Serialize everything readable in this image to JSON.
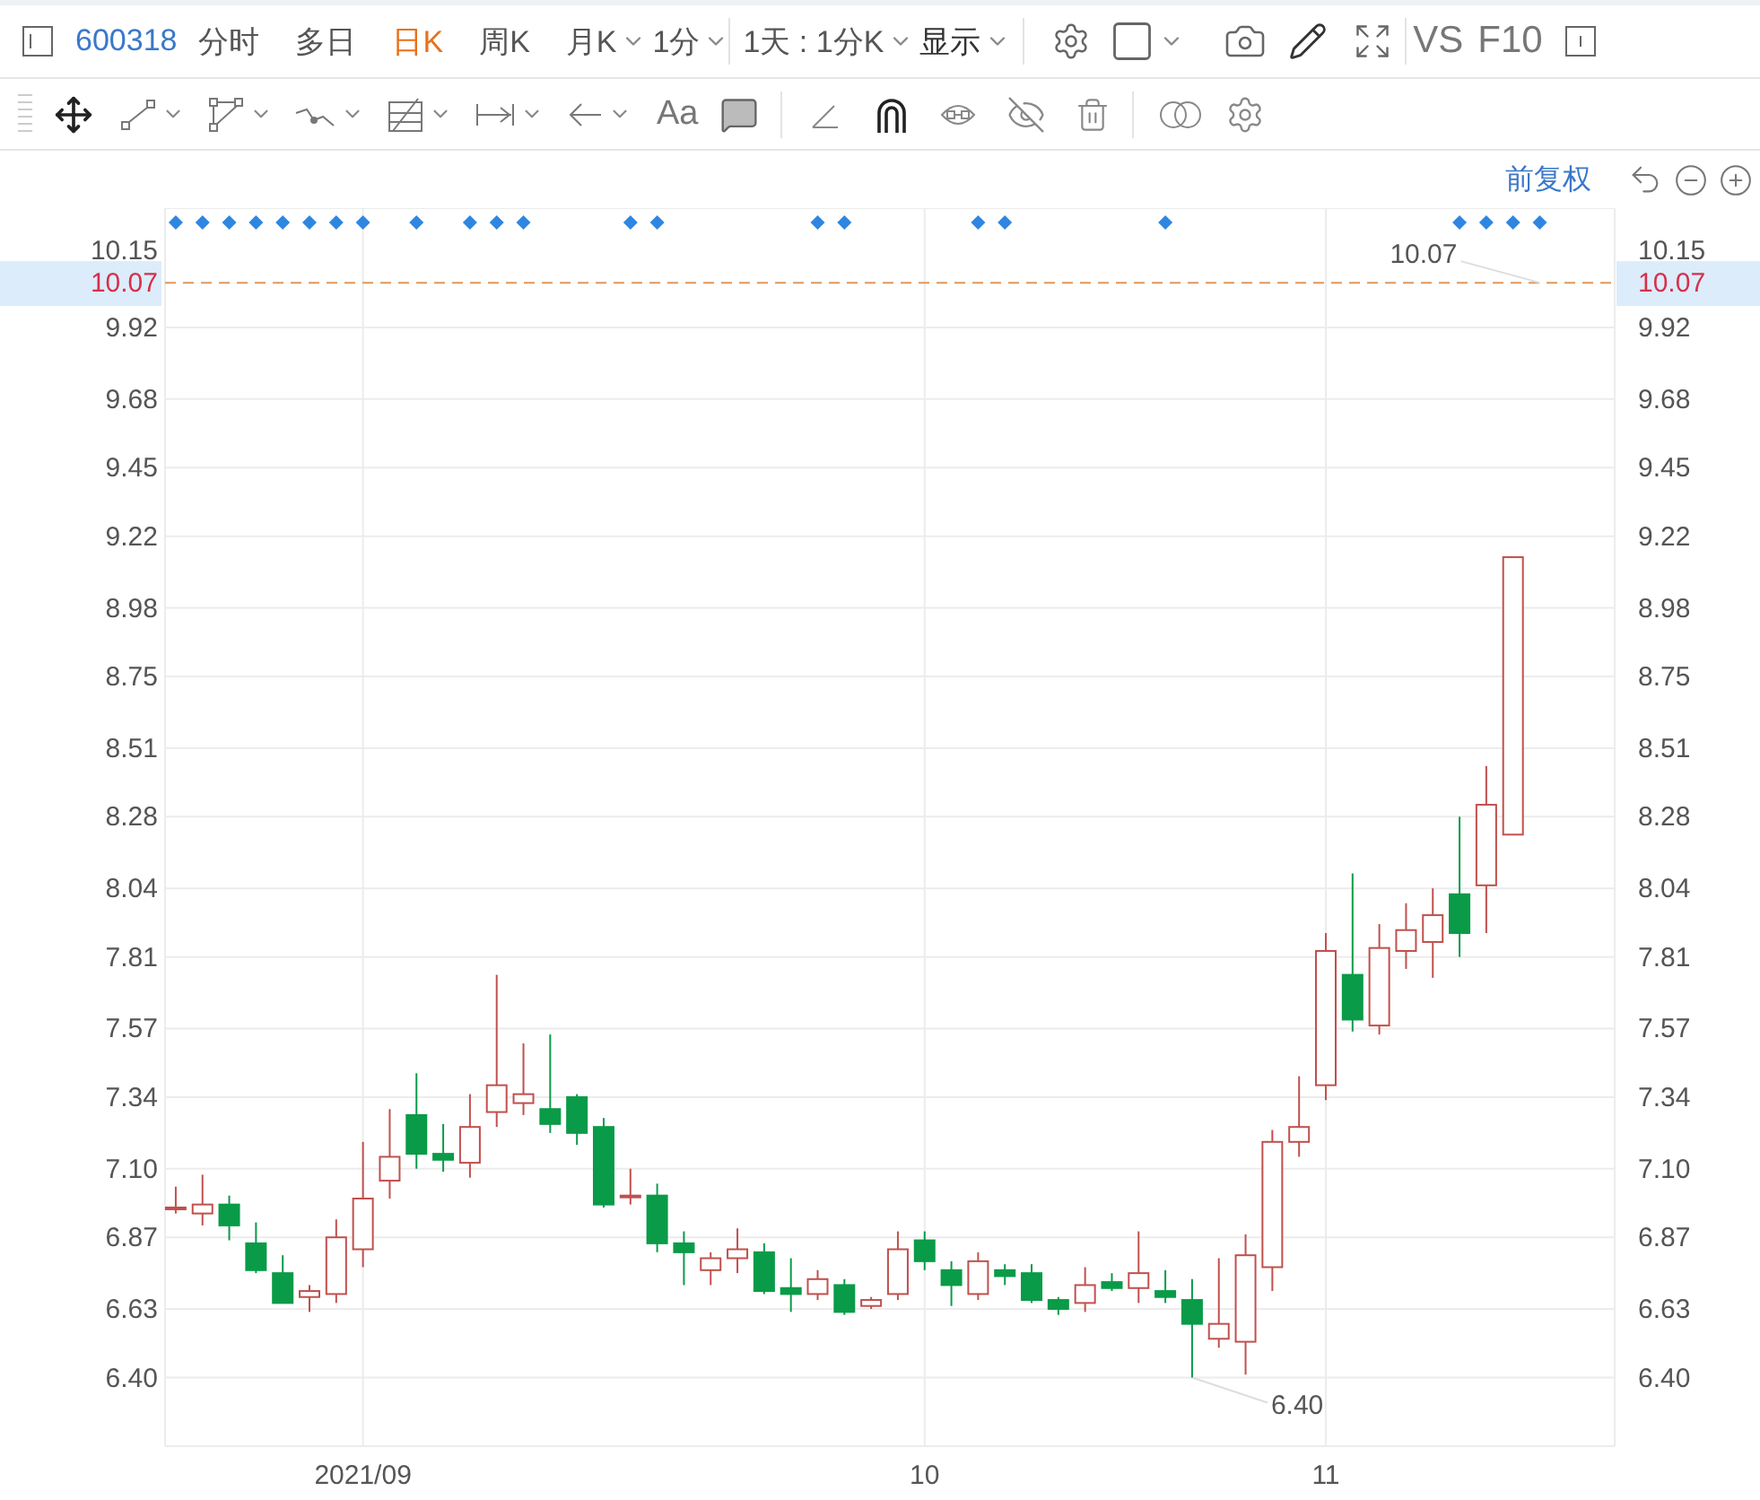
{
  "toolbar": {
    "symbol": "600318",
    "tabs": [
      {
        "label": "分时",
        "selected": false,
        "dropdown": false
      },
      {
        "label": "多日",
        "selected": false,
        "dropdown": false
      },
      {
        "label": "日K",
        "selected": true,
        "dropdown": false
      },
      {
        "label": "周K",
        "selected": false,
        "dropdown": false
      },
      {
        "label": "月K",
        "selected": false,
        "dropdown": true
      },
      {
        "label": "1分",
        "selected": false,
        "dropdown": true
      }
    ],
    "period": "1天 : 1分K",
    "display": "显示",
    "compare": "VS",
    "f10": "F10"
  },
  "drawing_toolbar": {
    "text_tool": "Aa"
  },
  "chart_header": {
    "adjust": "前复权"
  },
  "chart": {
    "price_tags": [
      "10.07",
      "10.07"
    ],
    "chart_data": {
      "type": "candlestick",
      "categories": [
        null,
        null,
        null,
        null,
        null,
        null,
        null,
        "2021/09",
        null,
        null,
        null,
        null,
        null,
        null,
        null,
        null,
        null,
        null,
        null,
        null,
        null,
        null,
        null,
        null,
        null,
        null,
        null,
        null,
        "10",
        null,
        null,
        null,
        null,
        null,
        null,
        null,
        null,
        null,
        null,
        null,
        null,
        null,
        null,
        "11",
        null,
        null,
        null,
        null,
        null,
        null,
        null
      ],
      "ohlc": [
        [
          6.97,
          7.04,
          6.95,
          6.97
        ],
        [
          6.95,
          7.08,
          6.91,
          6.98
        ],
        [
          6.98,
          7.01,
          6.86,
          6.91
        ],
        [
          6.85,
          6.92,
          6.75,
          6.76
        ],
        [
          6.75,
          6.81,
          6.65,
          6.65
        ],
        [
          6.67,
          6.71,
          6.62,
          6.69
        ],
        [
          6.68,
          6.93,
          6.65,
          6.87
        ],
        [
          6.83,
          7.19,
          6.77,
          7.0
        ],
        [
          7.06,
          7.3,
          7.0,
          7.14
        ],
        [
          7.28,
          7.42,
          7.1,
          7.15
        ],
        [
          7.15,
          7.25,
          7.09,
          7.13
        ],
        [
          7.12,
          7.35,
          7.07,
          7.24
        ],
        [
          7.29,
          7.75,
          7.24,
          7.38
        ],
        [
          7.32,
          7.52,
          7.28,
          7.35
        ],
        [
          7.3,
          7.55,
          7.22,
          7.25
        ],
        [
          7.34,
          7.35,
          7.18,
          7.22
        ],
        [
          7.24,
          7.27,
          6.97,
          6.98
        ],
        [
          7.01,
          7.1,
          6.98,
          7.01
        ],
        [
          7.01,
          7.05,
          6.82,
          6.85
        ],
        [
          6.85,
          6.89,
          6.71,
          6.82
        ],
        [
          6.76,
          6.82,
          6.71,
          6.8
        ],
        [
          6.8,
          6.9,
          6.75,
          6.83
        ],
        [
          6.82,
          6.85,
          6.68,
          6.69
        ],
        [
          6.7,
          6.8,
          6.62,
          6.68
        ],
        [
          6.68,
          6.76,
          6.66,
          6.73
        ],
        [
          6.71,
          6.73,
          6.61,
          6.62
        ],
        [
          6.64,
          6.67,
          6.63,
          6.66
        ],
        [
          6.68,
          6.89,
          6.66,
          6.83
        ],
        [
          6.86,
          6.89,
          6.76,
          6.79
        ],
        [
          6.76,
          6.79,
          6.64,
          6.71
        ],
        [
          6.68,
          6.82,
          6.66,
          6.79
        ],
        [
          6.76,
          6.78,
          6.71,
          6.74
        ],
        [
          6.75,
          6.78,
          6.65,
          6.66
        ],
        [
          6.66,
          6.67,
          6.61,
          6.63
        ],
        [
          6.65,
          6.77,
          6.62,
          6.71
        ],
        [
          6.72,
          6.75,
          6.69,
          6.7
        ],
        [
          6.7,
          6.89,
          6.65,
          6.75
        ],
        [
          6.69,
          6.76,
          6.65,
          6.67
        ],
        [
          6.66,
          6.73,
          6.4,
          6.58
        ],
        [
          6.53,
          6.8,
          6.5,
          6.58
        ],
        [
          6.52,
          6.88,
          6.41,
          6.81
        ],
        [
          6.77,
          7.23,
          6.69,
          7.19
        ],
        [
          7.19,
          7.41,
          7.14,
          7.24
        ],
        [
          7.38,
          7.89,
          7.33,
          7.83
        ],
        [
          7.75,
          8.09,
          7.56,
          7.6
        ],
        [
          7.58,
          7.92,
          7.55,
          7.84
        ],
        [
          7.83,
          7.99,
          7.77,
          7.9
        ],
        [
          7.86,
          8.04,
          7.74,
          7.95
        ],
        [
          8.02,
          8.28,
          7.81,
          7.89
        ],
        [
          8.05,
          8.45,
          7.89,
          8.32
        ],
        [
          8.22,
          9.15,
          8.22,
          9.15
        ]
      ],
      "ylim": [
        6.17,
        10.32
      ],
      "grid": true,
      "yticks": [
        {
          "value": 10.15,
          "label": "10.15"
        },
        {
          "value": 9.92,
          "label": "9.92"
        },
        {
          "value": 9.68,
          "label": "9.68"
        },
        {
          "value": 9.45,
          "label": "9.45"
        },
        {
          "value": 9.22,
          "label": "9.22"
        },
        {
          "value": 8.98,
          "label": "8.98"
        },
        {
          "value": 8.75,
          "label": "8.75"
        },
        {
          "value": 8.51,
          "label": "8.51"
        },
        {
          "value": 8.28,
          "label": "8.28"
        },
        {
          "value": 8.04,
          "label": "8.04"
        },
        {
          "value": 7.81,
          "label": "7.81"
        },
        {
          "value": 7.57,
          "label": "7.57"
        },
        {
          "value": 7.34,
          "label": "7.34"
        },
        {
          "value": 7.1,
          "label": "7.10"
        },
        {
          "value": 6.87,
          "label": "6.87"
        },
        {
          "value": 6.63,
          "label": "6.63"
        },
        {
          "value": 6.4,
          "label": "6.40"
        }
      ],
      "ref_lines": [
        {
          "axis": "y",
          "value": 10.07,
          "label": "10.07"
        }
      ],
      "annotations": [
        "6.40"
      ]
    }
  }
}
